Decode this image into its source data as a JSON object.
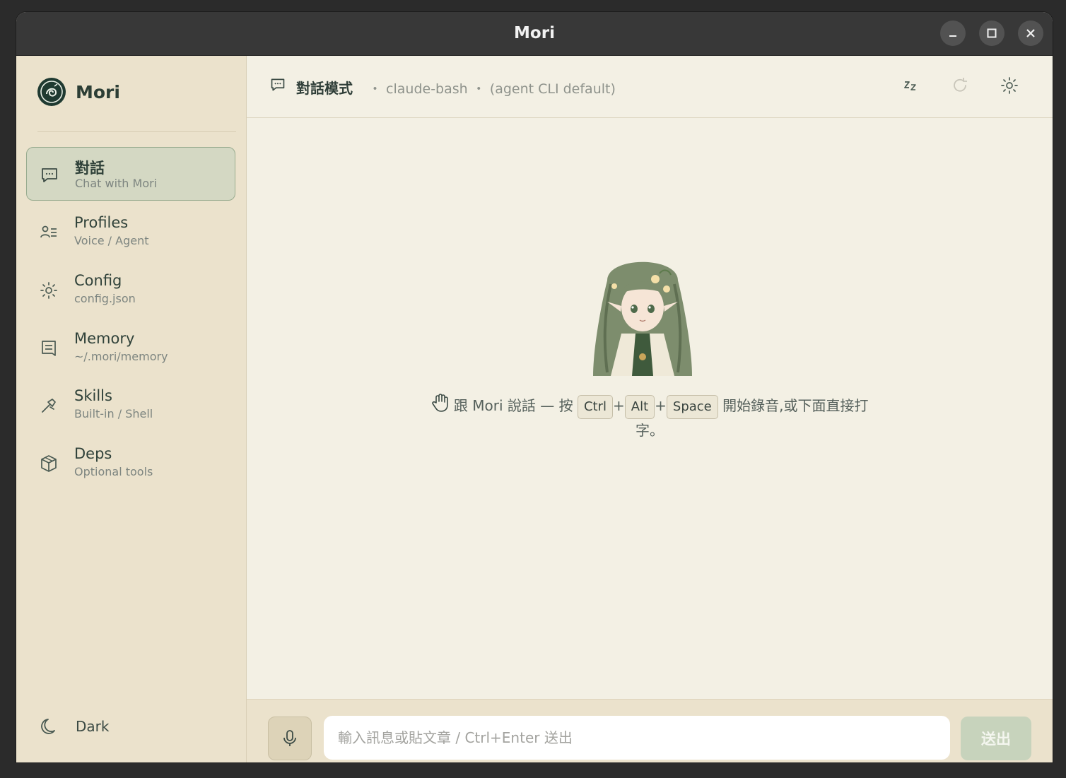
{
  "window": {
    "title": "Mori"
  },
  "brand": {
    "name": "Mori"
  },
  "nav": [
    {
      "label": "對話",
      "sub": "Chat with Mori",
      "icon": "chat-icon",
      "active": true
    },
    {
      "label": "Profiles",
      "sub": "Voice / Agent",
      "icon": "profiles-icon",
      "active": false
    },
    {
      "label": "Config",
      "sub": "config.json",
      "icon": "gear-icon",
      "active": false
    },
    {
      "label": "Memory",
      "sub": "~/.mori/memory",
      "icon": "memory-icon",
      "active": false
    },
    {
      "label": "Skills",
      "sub": "Built-in / Shell",
      "icon": "skills-icon",
      "active": false
    },
    {
      "label": "Deps",
      "sub": "Optional tools",
      "icon": "package-icon",
      "active": false
    }
  ],
  "theme": {
    "label": "Dark",
    "icon": "moon-icon"
  },
  "header": {
    "title": "對話模式",
    "meta": "・ claude-bash ・ (agent CLI default)",
    "icons": [
      "sleep-icon",
      "refresh-icon",
      "settings-icon"
    ]
  },
  "hint": {
    "icon": "hand-icon",
    "before": "跟 Mori 說話 — 按",
    "keys": [
      "Ctrl",
      "Alt",
      "Space"
    ],
    "plus": "+",
    "after": "開始錄音,或下面直接打字。"
  },
  "composer": {
    "placeholder": "輸入訊息或貼文章 / Ctrl+Enter 送出",
    "value": "",
    "send_label": "送出",
    "mic_icon": "microphone-icon"
  },
  "colors": {
    "sidebar_bg": "#ebe2cc",
    "main_bg": "#f3f0e4",
    "accent": "#98ab8f",
    "titlebar": "#383838"
  }
}
